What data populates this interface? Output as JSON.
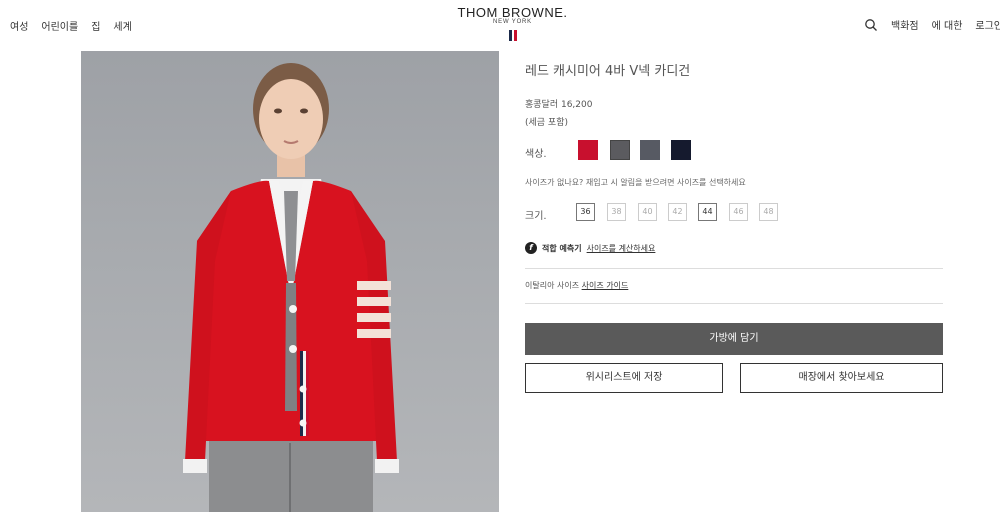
{
  "header": {
    "nav_left": [
      "여성",
      "어린이를",
      "집",
      "세계"
    ],
    "logo": {
      "main": "THOM BROWNE.",
      "sub": "NEW YORK"
    },
    "nav_right": {
      "stores": "백화점",
      "about": "에 대한",
      "login": "로그인"
    },
    "icons": {
      "search": "search-icon"
    }
  },
  "product": {
    "title": "레드 캐시미어 4바 V넥 카디건",
    "price": "홍콩달러 16,200",
    "tax_note": "(세금 포함)",
    "color_label": "색상.",
    "colors": [
      "#c8102e",
      "#5b5b5f",
      "#575a63",
      "#151a2e"
    ],
    "size_hint": "사이즈가 없나요? 재입고 시 알림을 받으려면 사이즈를 선택하세요",
    "size_label": "크기.",
    "sizes": [
      "36",
      "38",
      "40",
      "42",
      "44",
      "46",
      "48"
    ],
    "fit": {
      "icon": "fit-predictor-icon",
      "label": "적합 예측기",
      "link": "사이즈를 계산하세요"
    },
    "size_guide": {
      "text": "이탈리아 사이즈",
      "link": "사이즈 가이드"
    },
    "buttons": {
      "add_to_bag": "가방에 담기",
      "wishlist": "위시리스트에 저장",
      "find_in_store": "매장에서 찾아보세요"
    }
  },
  "colors": {
    "brand_red": "#c8102e",
    "brand_navy": "#1b2a4a",
    "primary_button": "#5a5a5a"
  }
}
